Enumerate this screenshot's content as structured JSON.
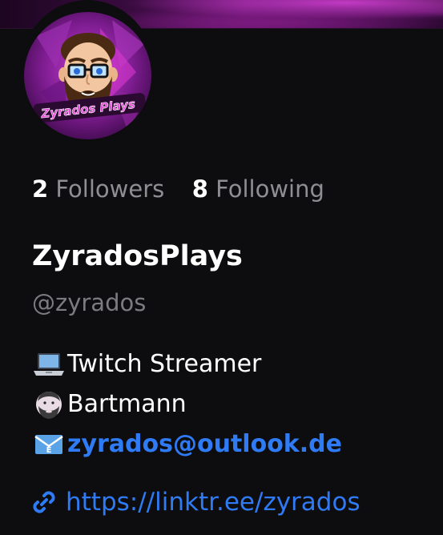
{
  "profile": {
    "display_name": "ZyradosPlays",
    "handle": "@zyrados",
    "avatar_text": "Zyrados Plays"
  },
  "stats": {
    "followers_count": "2",
    "followers_label": "Followers",
    "following_count": "8",
    "following_label": "Following"
  },
  "bio": {
    "line1_text": "Twitch Streamer",
    "line1_icon": "laptop-icon",
    "line2_text": "Bartmann",
    "line2_icon": "bearded-man-icon",
    "line3_text": "zyrados@outlook.de",
    "line3_icon": "email-icon"
  },
  "website": {
    "url": "https://linktr.ee/zyrados",
    "icon": "link-icon"
  },
  "colors": {
    "background": "#0d0d0f",
    "link": "#2f7bf5",
    "muted": "#8e8e93",
    "banner_accent": "#c23ac4"
  }
}
